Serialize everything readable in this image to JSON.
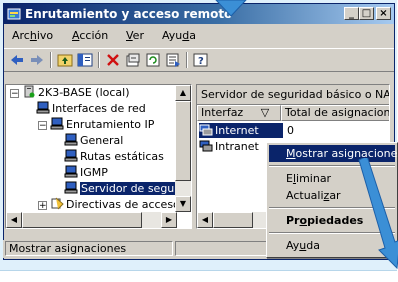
{
  "window": {
    "title": "Enrutamiento y acceso remoto",
    "controls": {
      "minimize": "_",
      "maximize": "□",
      "close": "×"
    }
  },
  "menubar": {
    "items": [
      {
        "prefix": "Arc",
        "key": "h",
        "suffix": "ivo"
      },
      {
        "prefix": "",
        "key": "A",
        "suffix": "cción"
      },
      {
        "prefix": "",
        "key": "V",
        "suffix": "er"
      },
      {
        "prefix": "Ayu",
        "key": "d",
        "suffix": "a"
      }
    ]
  },
  "toolbar": {
    "icons": [
      "back-icon",
      "forward-icon",
      "up-folder-icon",
      "show-hide-tree-icon",
      "delete-icon",
      "properties-icon",
      "refresh-icon",
      "export-list-icon",
      "help-icon"
    ]
  },
  "tree": {
    "items": [
      {
        "label": "2K3-BASE (local)",
        "icon": "server-icon",
        "expander": "−"
      },
      {
        "label": "Interfaces de red",
        "icon": "network-interfaces-icon"
      },
      {
        "label": "Enrutamiento IP",
        "icon": "ip-routing-icon",
        "expander": "−"
      },
      {
        "label": "General",
        "icon": "general-icon"
      },
      {
        "label": "Rutas estáticas",
        "icon": "static-routes-icon"
      },
      {
        "label": "IGMP",
        "icon": "igmp-icon"
      },
      {
        "label": "Servidor de segu",
        "icon": "nat-server-icon",
        "selected": true
      },
      {
        "label": "Directivas de acceso",
        "icon": "access-policies-icon",
        "expander": "+"
      }
    ]
  },
  "right_pane": {
    "header": "Servidor de seguridad básico o NAT",
    "columns": [
      "Interfaz",
      "Total de asignaciones"
    ],
    "sort_glyph": "▽",
    "rows": [
      {
        "interface": "Internet",
        "total": "0",
        "selected": true
      },
      {
        "interface": "Intranet",
        "total": ""
      }
    ]
  },
  "context_menu": {
    "items": [
      {
        "prefix": "",
        "key": "M",
        "suffix": "ostrar asignaciones...",
        "highlighted": true
      },
      {
        "prefix": "E",
        "key": "l",
        "suffix": "iminar"
      },
      {
        "prefix": "Actuali",
        "key": "z",
        "suffix": "ar"
      },
      {
        "prefix": "Pr",
        "key": "o",
        "suffix": "piedades",
        "bold": true
      },
      {
        "prefix": "Ay",
        "key": "u",
        "suffix": "da"
      }
    ]
  },
  "statusbar": {
    "text": "Mostrar asignaciones"
  },
  "colors": {
    "titlebar_start": "#0a246a",
    "titlebar_end": "#a6caf0",
    "selection": "#0a246a",
    "window_face": "#d4d0c8",
    "tutorial_arrow": "#3b8fd6"
  }
}
